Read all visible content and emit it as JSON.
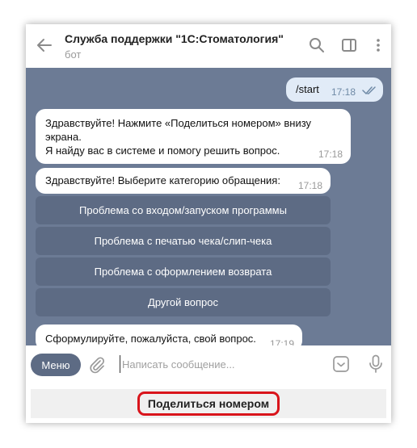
{
  "header": {
    "title": "Служба поддержки \"1С:Стоматология\"",
    "subtitle": "бот"
  },
  "messages": {
    "outgoing": {
      "text": "/start",
      "time": "17:18"
    },
    "greeting": {
      "line1": "Здравствуйте! Нажмите «Поделиться номером» внизу",
      "line2": "экрана.",
      "line3": "Я найду вас в системе и помогу решить вопрос.",
      "time": "17:18"
    },
    "category": {
      "text": "Здравствуйте! Выберите категорию обращения:",
      "time": "17:18"
    },
    "formulate": {
      "text": "Сформулируйте, пожалуйста, свой вопрос.",
      "time": "17:19"
    }
  },
  "inline_keyboard": [
    "Проблема со входом/запуском программы",
    "Проблема с печатью чека/слип-чека",
    "Проблема с оформлением возврата",
    "Другой вопрос"
  ],
  "input": {
    "menu_label": "Меню",
    "placeholder": "Написать сообщение..."
  },
  "reply_keyboard": {
    "share_label": "Поделиться номером"
  },
  "colors": {
    "chat_background": "#6c7b95",
    "button_background": "#5d6b84",
    "outgoing_bubble": "#e1ebf7",
    "highlight": "#d9141b"
  }
}
